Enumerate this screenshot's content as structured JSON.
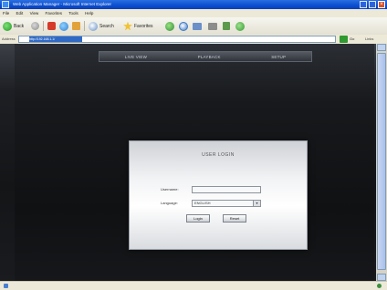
{
  "window": {
    "title": "Web Application Manager - Microsoft Internet Explorer"
  },
  "menu": {
    "items": [
      "File",
      "Edit",
      "View",
      "Favorites",
      "Tools",
      "Help"
    ]
  },
  "toolbar": {
    "back_label": "Back",
    "search_label": "Search",
    "favorites_label": "Favorites"
  },
  "address": {
    "label": "Address",
    "url": "http://192.168.1.1/",
    "go_label": "Go",
    "links_label": "Links"
  },
  "page": {
    "nav": [
      "LIVE VIEW",
      "PLAYBACK",
      "SETUP"
    ],
    "login": {
      "title": "USER LOGIN",
      "username_label": "Username:",
      "username_value": "",
      "language_label": "Language:",
      "language_value": "ENGLISH",
      "login_button": "Login",
      "reset_button": "Reset"
    }
  },
  "status": {
    "text": ""
  }
}
